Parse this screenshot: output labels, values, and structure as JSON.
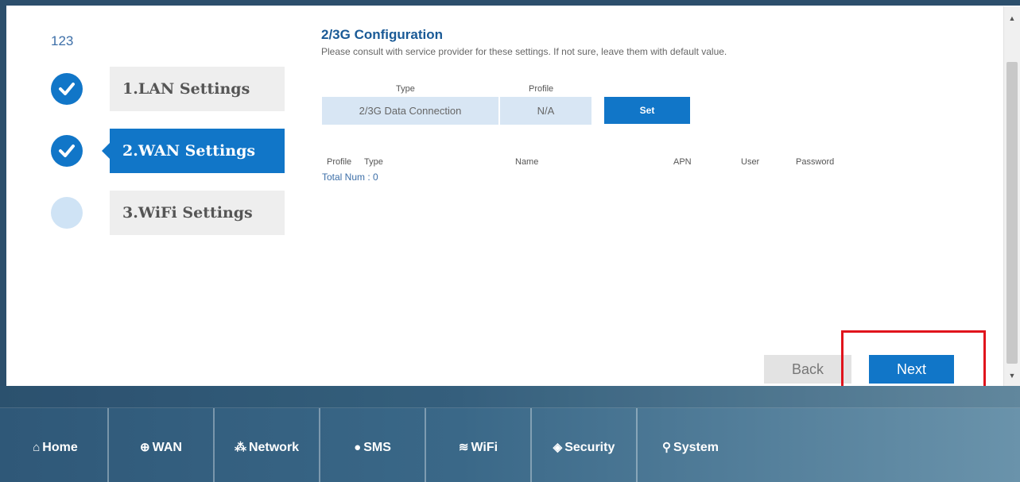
{
  "wizard": {
    "counter": "123",
    "steps": [
      {
        "label": "1.LAN Settings",
        "state": "done"
      },
      {
        "label": "2.WAN Settings",
        "state": "active"
      },
      {
        "label": "3.WiFi Settings",
        "state": "pending"
      }
    ]
  },
  "config": {
    "title": "2/3G Configuration",
    "description": "Please consult with service provider for these settings. If not sure, leave them with default value.",
    "type_header": "Type",
    "profile_header": "Profile",
    "type_value": "2/3G Data Connection",
    "profile_value": "N/A",
    "set_label": "Set"
  },
  "profiles_table": {
    "columns": [
      "Profile",
      "Type",
      "Name",
      "APN",
      "User",
      "Password"
    ],
    "total": "Total Num : 0"
  },
  "actions": {
    "back_label": "Back",
    "next_label": "Next"
  },
  "nav": {
    "items": [
      {
        "label": "Home",
        "icon": "home-icon"
      },
      {
        "label": "WAN",
        "icon": "globe-icon"
      },
      {
        "label": "Network",
        "icon": "network-icon"
      },
      {
        "label": "SMS",
        "icon": "sms-icon"
      },
      {
        "label": "WiFi",
        "icon": "wifi-icon"
      },
      {
        "label": "Security",
        "icon": "shield-icon"
      },
      {
        "label": "System",
        "icon": "key-icon"
      }
    ]
  },
  "colors": {
    "accent": "#1176c8",
    "highlight": "#e0141c",
    "nav_bg": "#2f5878"
  }
}
